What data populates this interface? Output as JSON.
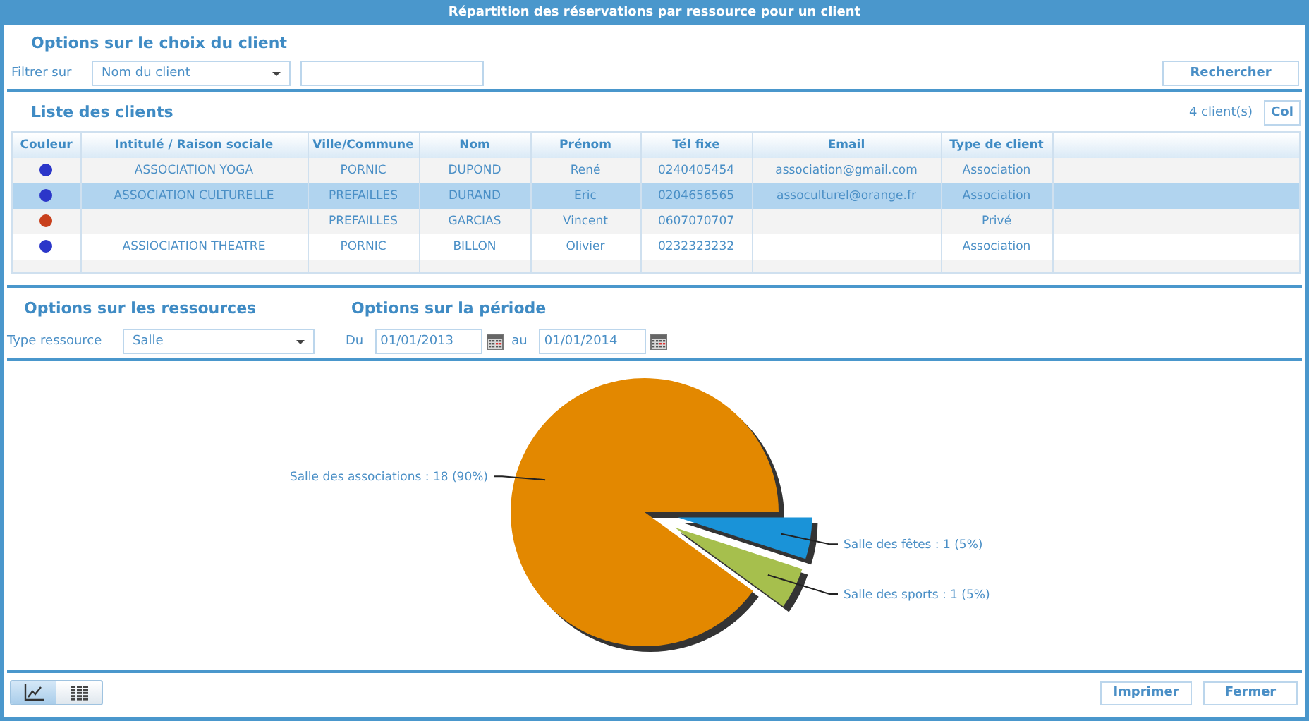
{
  "window": {
    "title": "Répartition des réservations par ressource pour un client"
  },
  "client_options": {
    "heading": "Options sur le choix du client",
    "filter_label": "Filtrer sur",
    "filter_select": "Nom du client",
    "search_button": "Rechercher"
  },
  "client_list": {
    "heading": "Liste des clients",
    "count": "4 client(s)",
    "col_button": "Col",
    "columns": [
      "Couleur",
      "Intitulé / Raison sociale",
      "Ville/Commune",
      "Nom",
      "Prénom",
      "Tél fixe",
      "Email",
      "Type de client"
    ],
    "rows": [
      {
        "color": "#2b36c9",
        "selected": false,
        "cells": [
          "",
          "ASSOCIATION YOGA",
          "PORNIC",
          "DUPOND",
          "René",
          "0240405454",
          "association@gmail.com",
          "Association"
        ]
      },
      {
        "color": "#2b36c9",
        "selected": true,
        "cells": [
          "",
          "ASSOCIATION CULTURELLE",
          "PREFAILLES",
          "DURAND",
          "Eric",
          "0204656565",
          "assoculturel@orange.fr",
          "Association"
        ]
      },
      {
        "color": "#c8401c",
        "selected": false,
        "cells": [
          "",
          "",
          "PREFAILLES",
          "GARCIAS",
          "Vincent",
          "0607070707",
          "",
          "Privé"
        ]
      },
      {
        "color": "#2b36c9",
        "selected": false,
        "cells": [
          "",
          "ASSIOCIATION THEATRE",
          "PORNIC",
          "BILLON",
          "Olivier",
          "0232323232",
          "",
          "Association"
        ]
      }
    ]
  },
  "resource_options": {
    "heading": "Options sur les ressources",
    "type_label": "Type ressource",
    "type_select": "Salle"
  },
  "period_options": {
    "heading": "Options sur la période",
    "from_label": "Du",
    "from_value": "01/01/2013",
    "to_label": "au",
    "to_value": "01/01/2014"
  },
  "chart": {
    "chart_data": {
      "type": "pie",
      "categories": [
        "Salle des associations",
        "Salle des fêtes",
        "Salle des sports"
      ],
      "values": [
        18,
        1,
        1
      ],
      "colors": [
        "#e38800",
        "#1a93d8",
        "#a6bf4d"
      ],
      "value_labels": [
        ": 18 (90%)",
        ": 1 (5%)",
        ": 1 (5%)"
      ]
    }
  },
  "view_toggle": [
    {
      "kind": "chart",
      "selected": true
    },
    {
      "kind": "grid",
      "selected": false
    }
  ],
  "buttons": [
    "Imprimer",
    "Fermer"
  ]
}
